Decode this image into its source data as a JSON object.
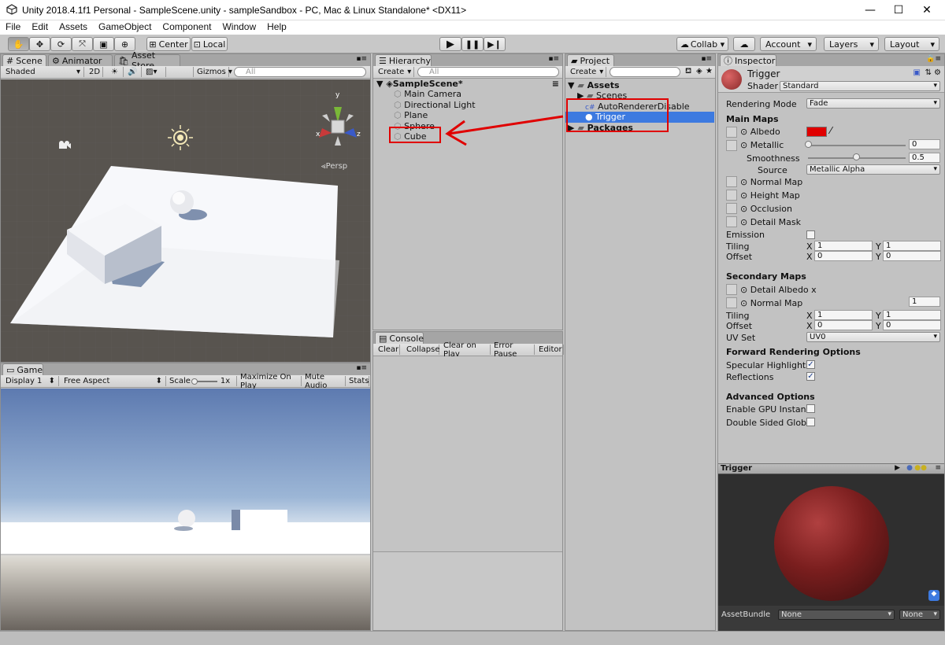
{
  "window": {
    "title": "Unity 2018.4.1f1 Personal - SampleScene.unity - sampleSandbox - PC, Mac & Linux Standalone* <DX11>"
  },
  "menu": [
    "File",
    "Edit",
    "Assets",
    "GameObject",
    "Component",
    "Window",
    "Help"
  ],
  "toolbar": {
    "pivot": "Center",
    "space": "Local",
    "collab": "Collab ▾",
    "account": "Account",
    "layers": "Layers",
    "layout": "Layout"
  },
  "scene": {
    "tabs": [
      "Scene",
      "Animator",
      "Asset Store"
    ],
    "shading": "Shaded",
    "mode2d": "2D",
    "gizmos": "Gizmos",
    "search_placeholder": "All",
    "persp": "Persp",
    "axis_y": "y",
    "axis_x": "x",
    "axis_z": "z"
  },
  "game": {
    "tab": "Game",
    "display": "Display 1",
    "aspect": "Free Aspect",
    "scale_label": "Scale",
    "scale_value": "1x",
    "maximize": "Maximize On Play",
    "mute": "Mute Audio",
    "stats": "Stats"
  },
  "hierarchy": {
    "tab": "Hierarchy",
    "create": "Create",
    "search_placeholder": "All",
    "scene_name": "SampleScene*",
    "items": [
      "Main Camera",
      "Directional Light",
      "Plane",
      "Sphere",
      "Cube"
    ]
  },
  "console": {
    "tab": "Console",
    "buttons": [
      "Clear",
      "Collapse",
      "Clear on Play",
      "Error Pause",
      "Editor"
    ]
  },
  "project": {
    "tab": "Project",
    "create": "Create",
    "assets": "Assets",
    "scenes": "Scenes",
    "script": "AutoRendererDisable",
    "material": "Trigger",
    "packages": "Packages"
  },
  "inspector": {
    "tab": "Inspector",
    "name": "Trigger",
    "shader_label": "Shader",
    "shader": "Standard",
    "rendering_mode_label": "Rendering Mode",
    "rendering_mode": "Fade",
    "main_maps": "Main Maps",
    "albedo": "Albedo",
    "albedo_color": "#e00000",
    "metallic": "Metallic",
    "metallic_value": "0",
    "metallic_fraction": 0.0,
    "smoothness": "Smoothness",
    "smoothness_value": "0.5",
    "smoothness_fraction": 0.5,
    "source_label": "Source",
    "source": "Metallic Alpha",
    "normal_map": "Normal Map",
    "height_map": "Height Map",
    "occlusion": "Occlusion",
    "detail_mask": "Detail Mask",
    "emission": "Emission",
    "tiling": "Tiling",
    "offset": "Offset",
    "x": "X",
    "y": "Y",
    "tiling_x": "1",
    "tiling_y": "1",
    "offset_x": "0",
    "offset_y": "0",
    "secondary_maps": "Secondary Maps",
    "detail_albedo": "Detail Albedo x",
    "sec_normal_map": "Normal Map",
    "sec_normal_value": "1",
    "sec_tiling_x": "1",
    "sec_tiling_y": "1",
    "sec_offset_x": "0",
    "sec_offset_y": "0",
    "uv_set_label": "UV Set",
    "uv_set": "UV0",
    "forward": "Forward Rendering Options",
    "specular": "Specular Highlights",
    "reflections": "Reflections",
    "advanced": "Advanced Options",
    "gpu_instancing": "Enable GPU Instancii",
    "double_sided": "Double Sided Global",
    "preview_title": "Trigger",
    "assetbundle_label": "AssetBundle",
    "assetbundle": "None",
    "variant": "None"
  },
  "colors": {
    "accent_selection": "#3d7ae0",
    "annotation": "#e00000",
    "material": "#7a1e1e"
  }
}
